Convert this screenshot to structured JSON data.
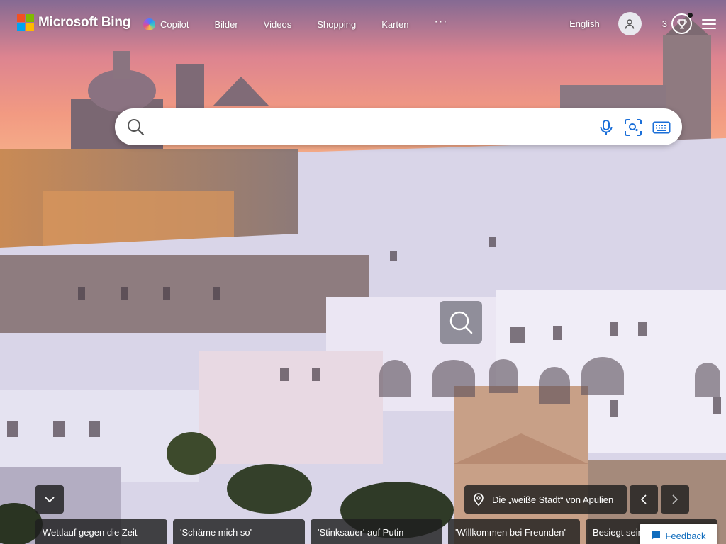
{
  "brand": {
    "name": "Microsoft Bing"
  },
  "nav": {
    "items": [
      {
        "label": "Copilot",
        "icon": "copilot-icon"
      },
      {
        "label": "Bilder"
      },
      {
        "label": "Videos"
      },
      {
        "label": "Shopping"
      },
      {
        "label": "Karten"
      }
    ],
    "more_label": "···"
  },
  "header_tools": {
    "language": "English",
    "rewards_points": "3",
    "icons": [
      "user-avatar-icon",
      "trophy-icon",
      "hamburger-menu-icon"
    ]
  },
  "search": {
    "value": "",
    "placeholder": "",
    "tools": [
      "microphone-icon",
      "visual-search-icon",
      "keyboard-icon"
    ]
  },
  "image_info": {
    "title": "Die „weiße Stadt“ von Apulien",
    "icon": "location-pin-icon"
  },
  "news": [
    {
      "title": "Wettlauf gegen die Zeit"
    },
    {
      "title": "'Schäme mich so'"
    },
    {
      "title": "'Stinksauer' auf Putin"
    },
    {
      "title": "'Willkommen bei Freunden'"
    },
    {
      "title": "Besiegt sein"
    }
  ],
  "feedback": {
    "label": "Feedback"
  },
  "colors": {
    "sky_top": "#8d6f9a",
    "sky_mid": "#e88a8a",
    "sky_low": "#f4a07c",
    "town": "#e6e4f2",
    "accent_link": "#0f6cbd"
  }
}
